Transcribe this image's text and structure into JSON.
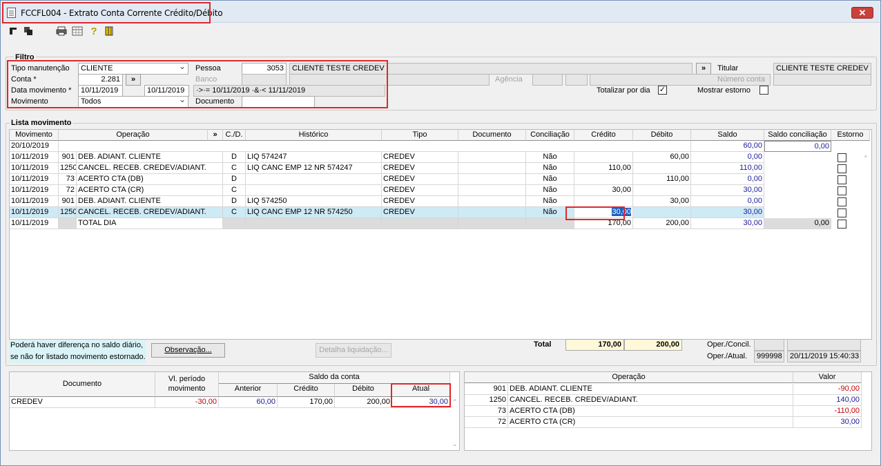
{
  "window": {
    "title": "FCCFL004 - Extrato Conta Corrente Crédito/Débito",
    "close_glyph": "✕"
  },
  "toolbar": [
    "nav-first-icon",
    "nav-back-icon",
    "printer-icon",
    "calculator-icon",
    "help-icon",
    "exit-icon"
  ],
  "filtro": {
    "title": "Filtro",
    "tipo_manutencao_label": "Tipo manutenção",
    "tipo_manutencao_value": "CLIENTE",
    "pessoa_label": "Pessoa",
    "pessoa_code": "3053",
    "pessoa_name": "CLIENTE TESTE CREDEV",
    "titular_label": "Titular",
    "titular_value": "CLIENTE TESTE CREDEV",
    "conta_label": "Conta *",
    "conta_value": "2.281",
    "banco_label": "Banco",
    "agencia_label": "Agência",
    "numero_conta_label": "Número conta",
    "data_mov_label": "Data movimento *",
    "data_ini": "10/11/2019",
    "data_fim": "10/11/2019",
    "data_expr": "·>·= 10/11/2019 ·&·< 11/11/2019",
    "totalizar_label": "Totalizar por dia",
    "totalizar_checked": "✓",
    "mostrar_estorno_label": "Mostrar estorno",
    "movimento_label": "Movimento",
    "movimento_value": "Todos",
    "documento_label": "Documento",
    "more_glyph": "»"
  },
  "lista": {
    "title": "Lista movimento",
    "columns": [
      "Movimento",
      "Operação",
      "»",
      "C./D.",
      "Histórico",
      "Tipo",
      "Documento",
      "Conciliação",
      "Crédito",
      "Débito",
      "Saldo",
      "Saldo conciliação",
      "Estorno"
    ],
    "opening": {
      "date": "20/10/2019",
      "saldo": "60,00",
      "saldo_conc": "0,00"
    },
    "rows": [
      {
        "date": "10/11/2019",
        "op": "901",
        "op_desc": "DEB. ADIANT. CLIENTE",
        "cd": "D",
        "hist": "LIQ  574247",
        "tipo": "CREDEV",
        "doc": "",
        "conc": "Não",
        "cred": "",
        "deb": "60,00",
        "saldo": "0,00"
      },
      {
        "date": "10/11/2019",
        "op": "1250",
        "op_desc": "CANCEL. RECEB. CREDEV/ADIANT.",
        "cd": "C",
        "hist": "LIQ  CANC    EMP 12 NR 574247",
        "tipo": "CREDEV",
        "doc": "",
        "conc": "Não",
        "cred": "110,00",
        "deb": "",
        "saldo": "110,00"
      },
      {
        "date": "10/11/2019",
        "op": "73",
        "op_desc": "ACERTO CTA (DB)",
        "cd": "D",
        "hist": "",
        "tipo": "CREDEV",
        "doc": "",
        "conc": "Não",
        "cred": "",
        "deb": "110,00",
        "saldo": "0,00"
      },
      {
        "date": "10/11/2019",
        "op": "72",
        "op_desc": "ACERTO CTA (CR)",
        "cd": "C",
        "hist": "",
        "tipo": "CREDEV",
        "doc": "",
        "conc": "Não",
        "cred": "30,00",
        "deb": "",
        "saldo": "30,00"
      },
      {
        "date": "10/11/2019",
        "op": "901",
        "op_desc": "DEB. ADIANT. CLIENTE",
        "cd": "D",
        "hist": "LIQ  574250",
        "tipo": "CREDEV",
        "doc": "",
        "conc": "Não",
        "cred": "",
        "deb": "30,00",
        "saldo": "0,00"
      },
      {
        "date": "10/11/2019",
        "op": "1250",
        "op_desc": "CANCEL. RECEB. CREDEV/ADIANT.",
        "cd": "C",
        "hist": "LIQ  CANC    EMP 12 NR 574250",
        "tipo": "CREDEV",
        "doc": "",
        "conc": "Não",
        "cred": "30,00",
        "deb": "",
        "saldo": "30,00"
      }
    ],
    "total_row": {
      "date": "10/11/2019",
      "label": "TOTAL DIA",
      "cred": "170,00",
      "deb": "200,00",
      "saldo": "30,00",
      "saldo_conc": "0,00"
    },
    "note_line1": "Poderá haver diferença no saldo diário,",
    "note_line2": "se não for listado movimento estornado.",
    "observacao_btn": "Observação...",
    "detalha_btn": "Detalha liquidação...",
    "total_label": "Total",
    "total_cred": "170,00",
    "total_deb": "200,00",
    "oper_concil_label": "Oper./Concil.",
    "oper_atual_label": "Oper./Atual.",
    "oper_atual_code": "999998",
    "oper_atual_ts": "20/11/2019 15:40:33"
  },
  "resumo": {
    "h_documento": "Documento",
    "h_vl_periodo": "Vl. período movimento",
    "h_saldo_conta": "Saldo da conta",
    "h_anterior": "Anterior",
    "h_credito": "Crédito",
    "h_debito": "Débito",
    "h_atual": "Atual",
    "row": {
      "doc": "CREDEV",
      "vl": "-30,00",
      "anterior": "60,00",
      "credito": "170,00",
      "debito": "200,00",
      "atual": "30,00"
    }
  },
  "operacoes": {
    "h_operacao": "Operação",
    "h_valor": "Valor",
    "rows": [
      {
        "code": "901",
        "desc": "DEB. ADIANT. CLIENTE",
        "valor": "-90,00"
      },
      {
        "code": "1250",
        "desc": "CANCEL. RECEB. CREDEV/ADIANT.",
        "valor": "140,00"
      },
      {
        "code": "73",
        "desc": "ACERTO CTA (DB)",
        "valor": "-110,00"
      },
      {
        "code": "72",
        "desc": "ACERTO CTA (CR)",
        "valor": "30,00"
      }
    ]
  }
}
